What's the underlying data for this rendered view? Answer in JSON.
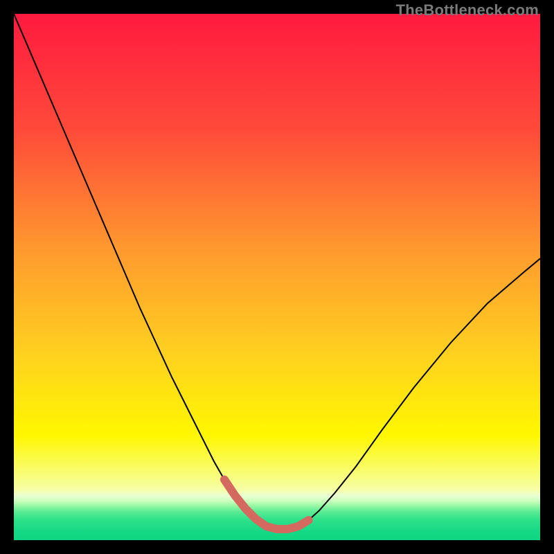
{
  "watermark": "TheBottleneck.com",
  "chart_data": {
    "type": "line",
    "title": "",
    "xlabel": "",
    "ylabel": "",
    "xlim": [
      0,
      100
    ],
    "ylim": [
      0,
      100
    ],
    "grid": false,
    "legend": false,
    "gradient_stops": [
      {
        "offset": 0.0,
        "color": "#ff1a3f"
      },
      {
        "offset": 0.22,
        "color": "#ff4a3a"
      },
      {
        "offset": 0.45,
        "color": "#ff9a2e"
      },
      {
        "offset": 0.65,
        "color": "#ffd21f"
      },
      {
        "offset": 0.8,
        "color": "#fff700"
      },
      {
        "offset": 0.905,
        "color": "#f6ffa8"
      },
      {
        "offset": 0.915,
        "color": "#eaffd2"
      },
      {
        "offset": 0.925,
        "color": "#cfffbf"
      },
      {
        "offset": 0.935,
        "color": "#96f7a3"
      },
      {
        "offset": 0.945,
        "color": "#5eec95"
      },
      {
        "offset": 0.96,
        "color": "#2fe28a"
      },
      {
        "offset": 0.985,
        "color": "#14d884"
      },
      {
        "offset": 1.0,
        "color": "#0fd682"
      }
    ],
    "series": [
      {
        "name": "bottleneck-curve",
        "color": "#000000",
        "stroke_width": 2,
        "x": [
          0,
          3,
          6,
          9,
          12,
          15,
          18,
          21,
          24,
          27,
          30,
          33,
          36,
          38,
          40,
          42,
          44,
          46,
          48,
          50,
          52,
          54,
          56,
          58,
          61,
          65,
          70,
          76,
          83,
          90,
          97,
          100
        ],
        "y": [
          100,
          93,
          86,
          79,
          72,
          65,
          58,
          51,
          44,
          37.5,
          31,
          25,
          19,
          15,
          11.5,
          8.5,
          6,
          4,
          2.6,
          2.1,
          2.1,
          2.6,
          3.8,
          5.6,
          9,
          14,
          21,
          29,
          37.5,
          45,
          51,
          53.5
        ]
      },
      {
        "name": "optimal-band",
        "color": "#d3695f",
        "stroke_width": 12,
        "linecap": "round",
        "x": [
          40,
          42,
          44,
          46,
          48,
          50,
          52,
          54,
          56
        ],
        "y": [
          11.5,
          8.5,
          6,
          4,
          2.6,
          2.1,
          2.1,
          2.6,
          3.8
        ]
      }
    ]
  }
}
